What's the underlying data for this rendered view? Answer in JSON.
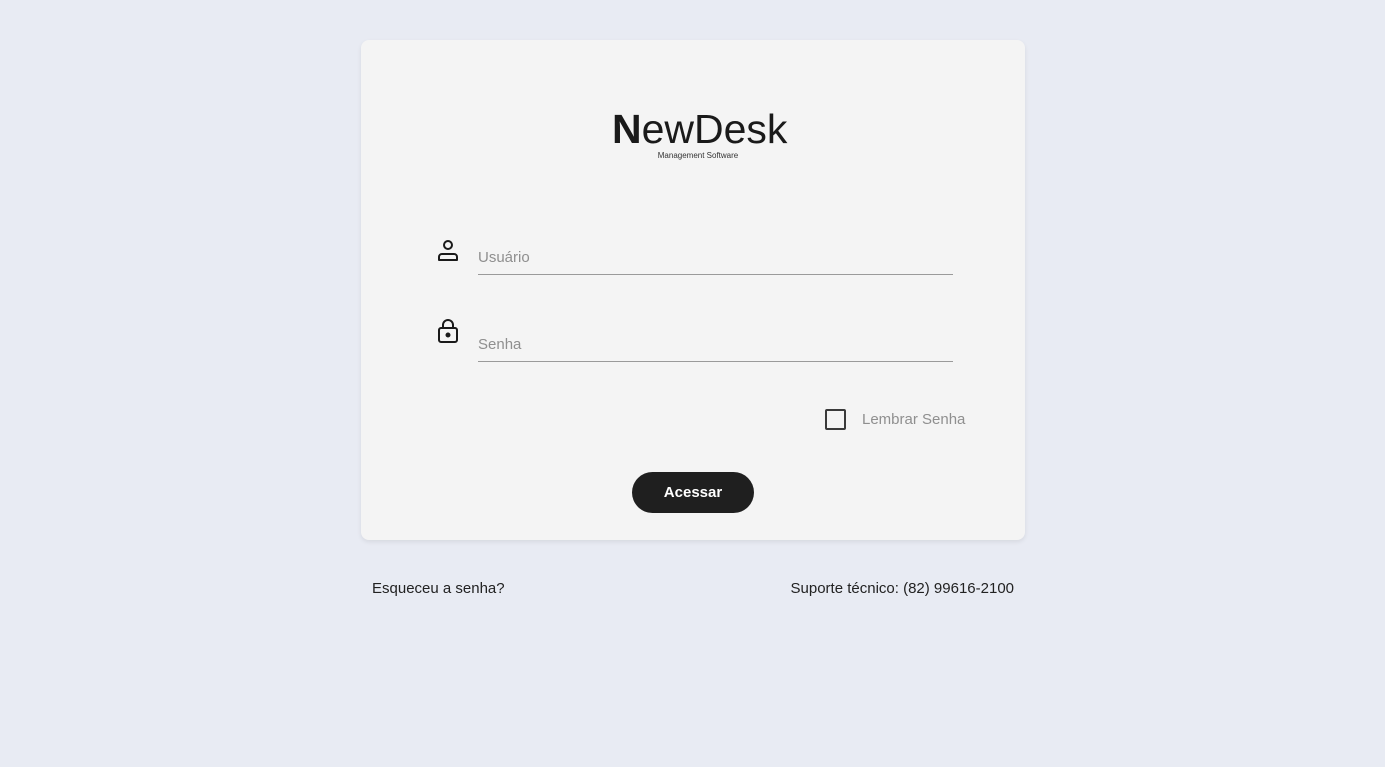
{
  "logo": {
    "first_letter": "N",
    "rest": "ewDesk",
    "subtitle": "Management Software"
  },
  "form": {
    "username": {
      "placeholder": "Usuário",
      "value": "",
      "icon": "user-icon"
    },
    "password": {
      "placeholder": "Senha",
      "value": "",
      "icon": "lock-icon"
    },
    "remember": {
      "label": "Lembrar Senha",
      "checked": false
    },
    "submit_label": "Acessar"
  },
  "footer": {
    "forgot_label": "Esqueceu a senha?",
    "support_text": "Suporte técnico: (82) 99616-2100"
  },
  "colors": {
    "page_background": "#e8ebf3",
    "card_background": "#f4f4f4",
    "button_background": "#1f1f1f",
    "button_text": "#ffffff",
    "placeholder": "#8f8f8f"
  }
}
